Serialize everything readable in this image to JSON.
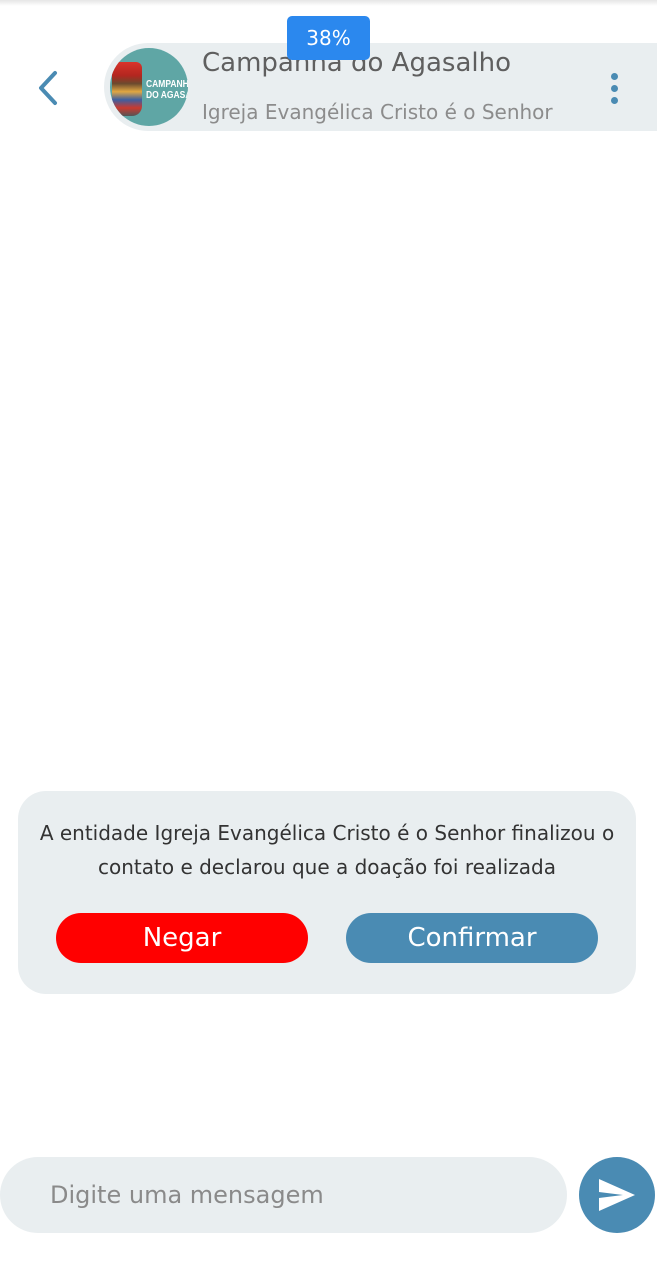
{
  "header": {
    "title": "Campanha do Agasalho",
    "subtitle": "Igreja Evangélica Cristo é o Senhor",
    "avatar_text_line1": "CAMPANHA",
    "avatar_text_line2": "DO AGASALHO",
    "progress": "38%",
    "accent_color": "#4a8bb3",
    "back_icon": "chevron-left-icon",
    "menu_icon": "more-vertical-icon"
  },
  "notice": {
    "message": "A entidade Igreja Evangélica Cristo é o Senhor  finalizou o contato e declarou que a doação foi realizada",
    "deny_label": "Negar",
    "confirm_label": "Confirmar",
    "deny_color": "#ff0000",
    "confirm_color": "#4a8bb3"
  },
  "composer": {
    "placeholder": "Digite uma mensagem",
    "value": "",
    "send_icon": "send-icon"
  }
}
